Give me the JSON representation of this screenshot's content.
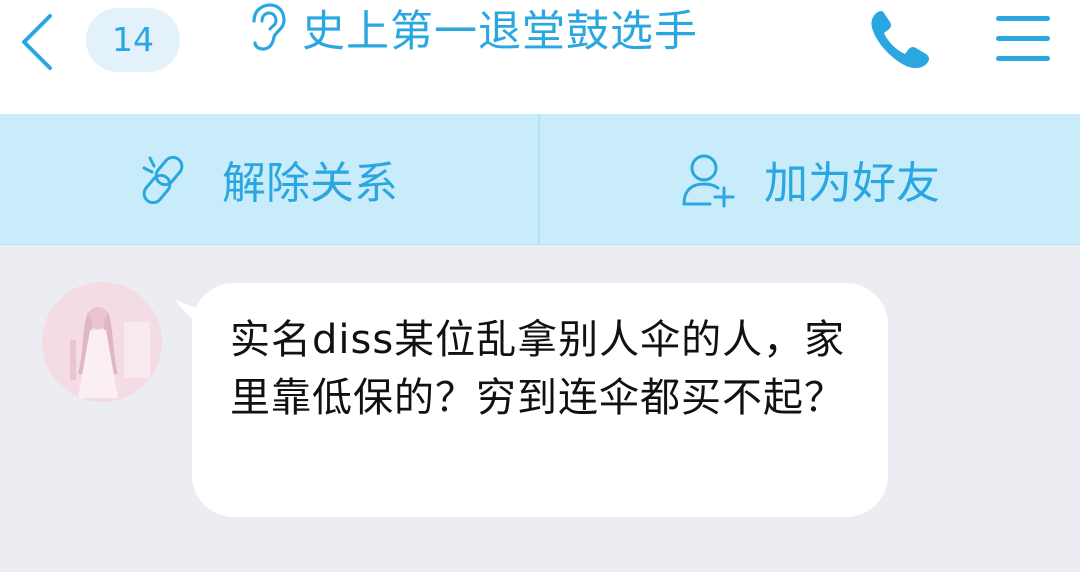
{
  "header": {
    "unread_count": "14",
    "title": "史上第一退堂鼓选手",
    "accent_color": "#2aa7e0",
    "icons": {
      "back": "chevron-left-icon",
      "mode": "ear-icon",
      "call": "phone-icon",
      "menu": "menu-icon"
    }
  },
  "actions": {
    "unlink_label": "解除关系",
    "add_friend_label": "加为好友",
    "icons": {
      "unlink": "broken-link-icon",
      "add_friend": "add-friend-icon"
    }
  },
  "chat": {
    "messages": [
      {
        "direction": "incoming",
        "text": "实名diss某位乱拿别人伞的人，家里靠低保的？穷到连伞都买不起？"
      }
    ]
  }
}
